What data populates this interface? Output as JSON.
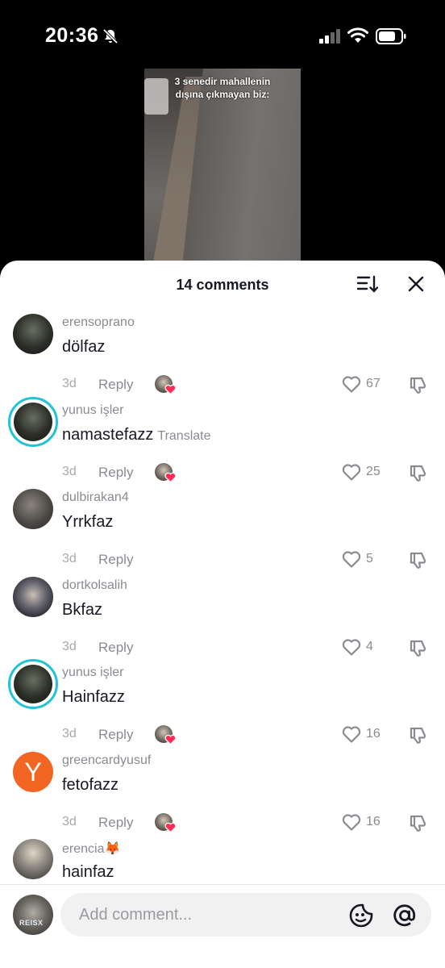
{
  "status_bar": {
    "time": "20:36"
  },
  "video": {
    "overlay_line1": "3 senedir mahallenin",
    "overlay_line2": "dışına çıkmayan biz:"
  },
  "sheet": {
    "comment_count": "14 comments"
  },
  "comments": [
    {
      "username": "erensoprano",
      "text": "dölfaz",
      "translate": "",
      "ago": "3d",
      "reply": "Reply",
      "likes": "67",
      "creator_liked": true,
      "avatar": "av-dark",
      "ring": false
    },
    {
      "username": "yunus işler",
      "text": "namastefazz",
      "translate": "Translate",
      "ago": "3d",
      "reply": "Reply",
      "likes": "25",
      "creator_liked": true,
      "avatar": "av-dark",
      "ring": true
    },
    {
      "username": "dulbirakan4",
      "text": "Yrrkfaz",
      "translate": "",
      "ago": "3d",
      "reply": "Reply",
      "likes": "5",
      "creator_liked": false,
      "avatar": "av-room",
      "ring": false
    },
    {
      "username": "dortkolsalih",
      "text": "Bkfaz",
      "translate": "",
      "ago": "3d",
      "reply": "Reply",
      "likes": "4",
      "creator_liked": false,
      "avatar": "av-cam",
      "ring": false
    },
    {
      "username": "yunus işler",
      "text": "Hainfazz",
      "translate": "",
      "ago": "3d",
      "reply": "Reply",
      "likes": "16",
      "creator_liked": true,
      "avatar": "av-dark",
      "ring": true
    },
    {
      "username": "greencardyusuf",
      "text": "fetofazz",
      "translate": "",
      "ago": "3d",
      "reply": "Reply",
      "likes": "16",
      "creator_liked": true,
      "avatar": "av-y",
      "avatar_letter": "Y",
      "ring": false
    },
    {
      "username": "erencia🦊",
      "text": "hainfaz",
      "translate": "",
      "ago": "",
      "reply": "",
      "likes": "",
      "creator_liked": false,
      "avatar": "av-mirror",
      "ring": false
    }
  ],
  "footer": {
    "placeholder": "Add comment...",
    "avatar_tag": "REISX"
  },
  "colors": {
    "ring": "#20c4d4",
    "heart_pink": "#fe2c55",
    "y_avatar": "#f26522"
  }
}
